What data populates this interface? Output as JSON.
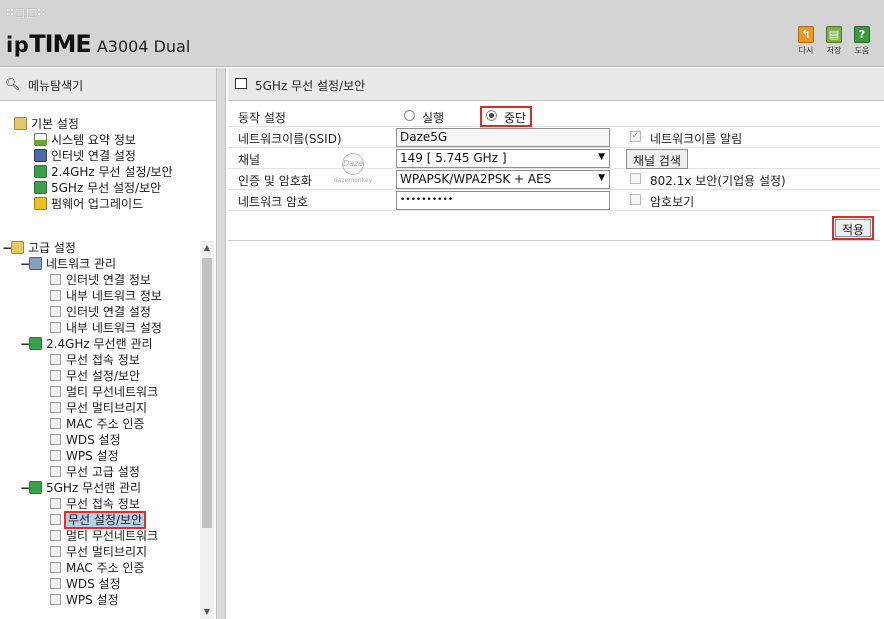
{
  "header": {
    "logo_dots": "∷□□∷",
    "brand_prefix": "ip",
    "brand_bold": "TIME",
    "model": "A3004 Dual",
    "tools": [
      {
        "label": "다시",
        "icon": "back-icon",
        "color": "#e89a24"
      },
      {
        "label": "저장",
        "icon": "save-icon",
        "color": "#7bb043"
      },
      {
        "label": "도움",
        "icon": "help-icon",
        "color": "#3c9a3a"
      }
    ]
  },
  "left": {
    "title": "메뉴탐색기",
    "basic_group": "기본 설정",
    "basic_items": [
      "시스템 요약 정보",
      "인터넷 연결 설정",
      "2.4GHz 무선 설정/보안",
      "5GHz 무선 설정/보안",
      "펌웨어 업그레이드"
    ],
    "advanced_group": "고급 설정",
    "network_group": "네트워크 관리",
    "network_items": [
      "인터넷 연결 정보",
      "내부 네트워크 정보",
      "인터넷 연결 설정",
      "내부 네트워크 설정"
    ],
    "wlan24_group": "2.4GHz 무선랜 관리",
    "wlan24_items": [
      "무선 접속 정보",
      "무선 설정/보안",
      "멀티 무선네트워크",
      "무선 멀티브리지",
      "MAC 주소 인증",
      "WDS 설정",
      "WPS 설정",
      "무선 고급 설정"
    ],
    "wlan5_group": "5GHz 무선랜 관리",
    "wlan5_items": [
      "무선 접속 정보",
      "무선 설정/보안",
      "멀티 무선네트워크",
      "무선 멀티브리지",
      "MAC 주소 인증",
      "WDS 설정",
      "WPS 설정"
    ]
  },
  "right": {
    "title": "5GHz 무선 설정/보안",
    "operation_label": "동작 설정",
    "run_label": "실행",
    "stop_label": "중단",
    "ssid_label": "네트워크이름(SSID)",
    "ssid_value": "Daze5G",
    "ssid_broadcast_label": "네트워크이름 알림",
    "channel_label": "채널",
    "channel_value": "149 [ 5.745 GHz ]",
    "channel_search": "채널 검색",
    "auth_label": "인증 및 암호화",
    "auth_value": "WPAPSK/WPA2PSK + AES",
    "dot1x_label": "802.1x 보안(기업용 설정)",
    "password_label": "네트워크 암호",
    "password_value": "••••••••••",
    "show_password_label": "암호보기",
    "apply": "적용",
    "watermark_logo": "Daze",
    "watermark_text": "dazemonkey"
  }
}
